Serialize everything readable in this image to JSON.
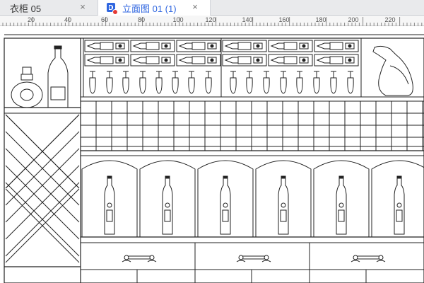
{
  "tabs": [
    {
      "label": "衣柜 05",
      "active": false,
      "close_glyph": "×"
    },
    {
      "label": "立面图 01 (1)",
      "active": true,
      "close_glyph": "×"
    }
  ],
  "ruler": {
    "labels": [
      "20",
      "40",
      "60",
      "80",
      "100",
      "120",
      "140",
      "160",
      "180",
      "200",
      "220"
    ]
  },
  "colors": {
    "accent": "#2f66e0",
    "line": "#222222",
    "tabbar": "#e9eaec",
    "badge": "#e53935"
  },
  "icons": {
    "document": "document-icon",
    "close": "close-icon"
  }
}
